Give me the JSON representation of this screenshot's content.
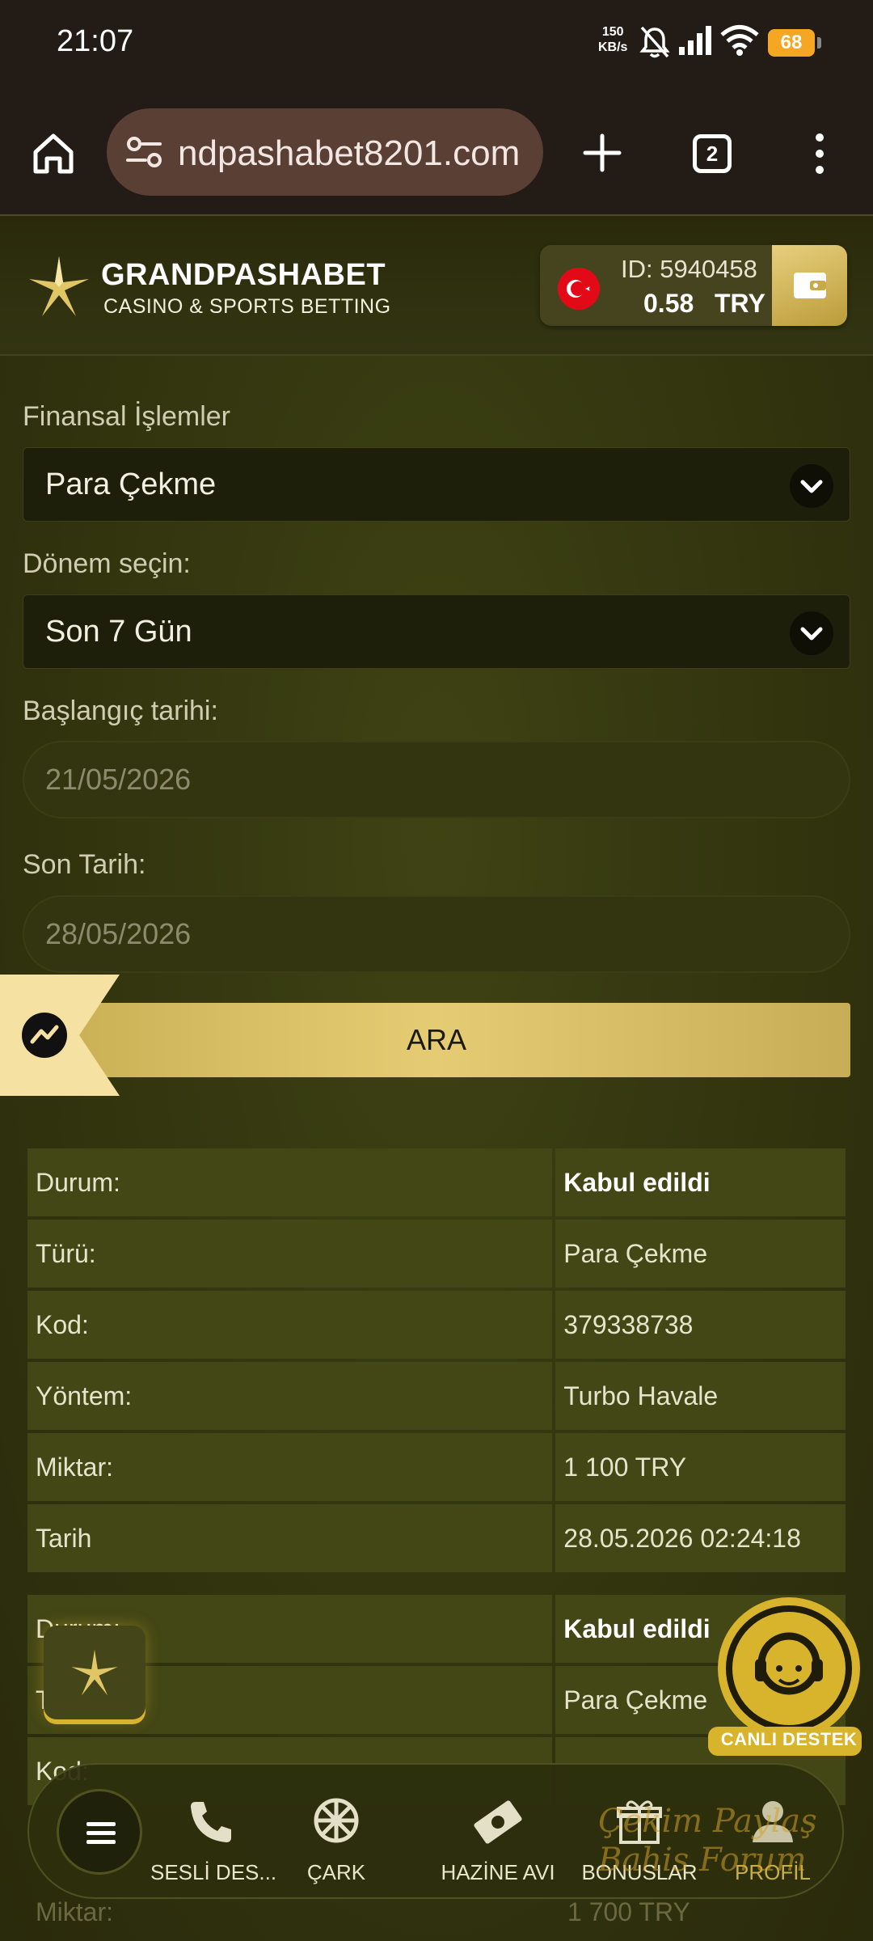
{
  "status_bar": {
    "time": "21:07",
    "net_speed_value": "150",
    "net_speed_unit": "KB/s",
    "battery": "68",
    "icons": [
      "bell-off-icon",
      "signal-icon",
      "wifi-icon",
      "battery-icon"
    ]
  },
  "browser": {
    "url": "ndpashabet8201.com",
    "tab_count": "2"
  },
  "header": {
    "brand_title": "GRANDPASHABET",
    "brand_subtitle": "CASINO & SPORTS BETTING",
    "account_id": "ID: 5940458",
    "balance": "0.58",
    "currency": "TRY"
  },
  "form": {
    "transactions_label": "Finansal İşlemler",
    "transactions_value": "Para Çekme",
    "period_label": "Dönem seçin:",
    "period_value": "Son 7 Gün",
    "start_label": "Başlangıç tarihi:",
    "start_value": "21/05/2026",
    "end_label": "Son Tarih:",
    "end_value": "28/05/2026",
    "search_label": "ARA"
  },
  "results": [
    {
      "status_label": "Durum:",
      "status_value": "Kabul edildi",
      "type_label": "Türü:",
      "type_value": "Para Çekme",
      "code_label": "Kod:",
      "code_value": "379338738",
      "method_label": "Yöntem:",
      "method_value": "Turbo Havale",
      "amount_label": "Miktar:",
      "amount_value": "1 100 TRY",
      "date_label": "Tarih",
      "date_value": "28.05.2026 02:24:18"
    },
    {
      "status_label": "Durum:",
      "status_value": "Kabul edildi",
      "type_label": "T",
      "type_value": "Para Çekme",
      "code_label": "Kod:",
      "amount_label": "Miktar:",
      "amount_partial": "1 700 TRY"
    }
  ],
  "floating": {
    "live_support_label": "CANLI DESTEK"
  },
  "bottom_nav": {
    "items": [
      {
        "label": "SESLİ DES...",
        "icon": "phone-icon"
      },
      {
        "label": "ÇARK",
        "icon": "wheel-icon"
      },
      {
        "label": "HAZİNE AVI",
        "icon": "money-icon"
      },
      {
        "label": "BONUSLAR",
        "icon": "gift-icon"
      },
      {
        "label": "PROFİL",
        "icon": "user-icon"
      }
    ]
  },
  "watermark": {
    "line1": "Çekim Paylaş",
    "line2": "Bahis Forum"
  },
  "colors": {
    "accent_gold": "#d8bf63",
    "background": "#34370f",
    "active_nav": "#c9b046"
  }
}
